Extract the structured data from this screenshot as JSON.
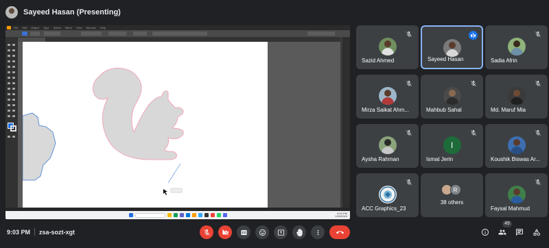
{
  "presenter": {
    "name": "Sayeed Hasan (Presenting)"
  },
  "shared_screen": {
    "menu_items": [
      "File",
      "Edit",
      "Object",
      "Type",
      "Select",
      "Effect",
      "View",
      "Window",
      "Help"
    ],
    "taskbar": {
      "time": "9:03 PM",
      "date": "1/30/2024"
    }
  },
  "participants": [
    {
      "name": "Sazid Ahmed",
      "muted": true
    },
    {
      "name": "Sayeed Hasan",
      "muted": false,
      "speaking": true
    },
    {
      "name": "Sadia Afrin",
      "muted": true
    },
    {
      "name": "Mirza Saikat Ahm...",
      "muted": true
    },
    {
      "name": "Mahbub Sahal",
      "muted": true
    },
    {
      "name": "Md. Maruf Mia",
      "muted": true
    },
    {
      "name": "Aysha Rahman",
      "muted": true
    },
    {
      "name": "Ismat Jerin",
      "initial": "I",
      "muted": true
    },
    {
      "name": "Koushik Biswas Ar...",
      "muted": true
    },
    {
      "name": "ACC Graphics_23",
      "muted": true
    },
    {
      "others_label": "38 others",
      "others_initial": "R"
    },
    {
      "name": "Faysal Mahmud",
      "muted": true
    }
  ],
  "meeting": {
    "time": "9:03 PM",
    "code": "zsa-sozt-xgt",
    "people_count": "49"
  },
  "controls": [
    "mic-off",
    "camera-off",
    "captions",
    "emoji",
    "present",
    "raise-hand",
    "more",
    "leave-call"
  ],
  "right_controls": [
    "info",
    "people",
    "chat",
    "activities"
  ],
  "colors": {
    "background": "#202124",
    "tile": "#3c4043",
    "active_border": "#8ab4f8",
    "danger": "#ea4335",
    "speaking": "#1a73e8"
  }
}
